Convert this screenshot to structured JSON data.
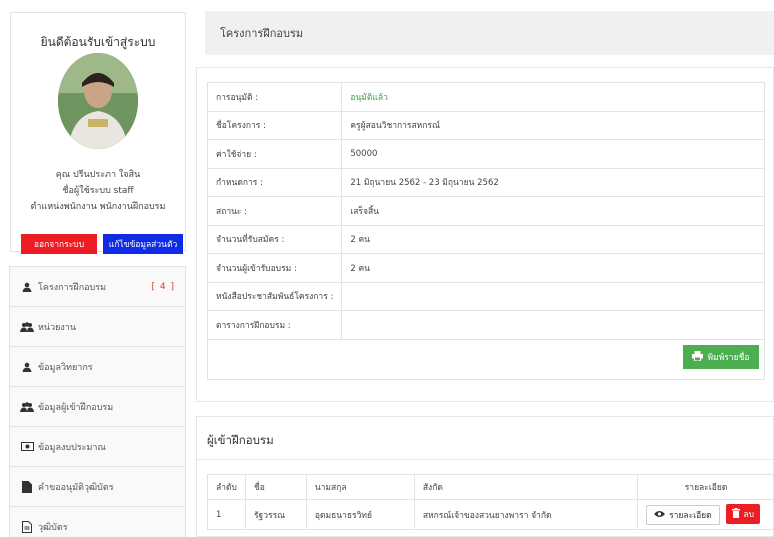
{
  "profile": {
    "welcome": "ยินดีต้อนรับเข้าสู่ระบบ",
    "name": "คุณ ปรีนประภา ใจสิน",
    "username": "ชื่อผู้ใช้ระบบ staff",
    "position": "ตำแหน่งพนักงาน พนักงานฝึกอบรม",
    "logout_label": "ออกจากระบบ",
    "edit_label": "แก้ไขข้อมูลส่วนตัว"
  },
  "sidebar": {
    "items": [
      {
        "label": "โครงการฝึกอบรม",
        "icon": "user-icon",
        "count": "[ 4 ]"
      },
      {
        "label": "หน่วยงาน",
        "icon": "users-icon"
      },
      {
        "label": "ข้อมูลวิทยากร",
        "icon": "user-icon"
      },
      {
        "label": "ข้อมูลผู้เข้าฝึกอบรม",
        "icon": "users-icon"
      },
      {
        "label": "ข้อมูลงบประมาณ",
        "icon": "money-icon"
      },
      {
        "label": "คำขออนุมัติวุฒิบัตร",
        "icon": "file-icon"
      },
      {
        "label": "วุฒิบัตร",
        "icon": "document-icon"
      }
    ]
  },
  "header": {
    "title": "โครงการฝึกอบรม"
  },
  "details": {
    "rows": [
      {
        "label": "การอนุมัติ :",
        "value": "อนุมัติแล้ว"
      },
      {
        "label": "ชื่อโครงการ :",
        "value": "ครูผู้สอนวิชาการสหกรณ์"
      },
      {
        "label": "ค่าใช้จ่าย :",
        "value": "50000"
      },
      {
        "label": "กำหนดการ :",
        "value": "21 มิถุนายน 2562 - 23 มิถุนายน 2562"
      },
      {
        "label": "สถานะ :",
        "value": "เสร็จสิ้น"
      },
      {
        "label": "จำนวนที่รับสมัคร :",
        "value": "2 คน"
      },
      {
        "label": "จำนวนผู้เข้ารับอบรม :",
        "value": "2 คน"
      },
      {
        "label": "หนังสือประชาสัมพันธ์โครงการ :",
        "value": ""
      },
      {
        "label": "ตารางการฝึกอบรม :",
        "value": ""
      }
    ],
    "print_label": "พิมพ์รายชื่อ"
  },
  "participants": {
    "title": "ผู้เข้าฝึกอบรม",
    "columns": [
      "ลำดับ",
      "ชื่อ",
      "นามสกุล",
      "สังกัด",
      "รายละเอียด"
    ],
    "rows": [
      {
        "no": "1",
        "first": "รัฐวรรณ",
        "last": "อุดมธนาธรวิทย์",
        "org": "สหกรณ์เจ้าของสวนยางพารา จำกัด",
        "view_label": "รายละเอียด",
        "delete_label": "ลบ"
      }
    ]
  },
  "colors": {
    "success": "#4bae4f",
    "danger": "#ee1d23",
    "primary": "#0f2be6",
    "approved_text": "#3aa544"
  }
}
